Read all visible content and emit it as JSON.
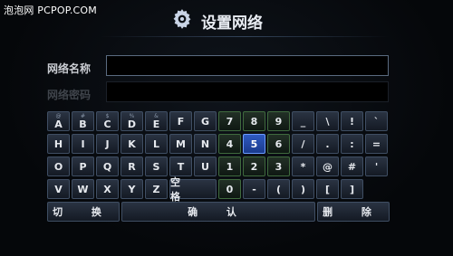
{
  "watermark": "泡泡网 PCPOP.COM",
  "header": {
    "title": "设置网络",
    "icon": "gear-icon"
  },
  "form": {
    "ssid_label": "网络名称",
    "ssid_value": "",
    "password_label": "网络密码",
    "password_value": ""
  },
  "keyboard": {
    "selected_key": "5",
    "rows": [
      [
        {
          "sub": "@",
          "label": "A"
        },
        {
          "sub": "#",
          "label": "B"
        },
        {
          "sub": "$",
          "label": "C"
        },
        {
          "sub": "%",
          "label": "D"
        },
        {
          "sub": "&",
          "label": "E"
        },
        {
          "sub": "",
          "label": "F"
        },
        {
          "sub": "",
          "label": "G"
        },
        {
          "sub": "",
          "label": "7"
        },
        {
          "sub": "",
          "label": "8"
        },
        {
          "sub": "",
          "label": "9"
        },
        {
          "sub": "",
          "label": "_"
        },
        {
          "sub": "",
          "label": "\\"
        },
        {
          "sub": "",
          "label": "!"
        },
        {
          "sub": "",
          "label": "`"
        }
      ],
      [
        {
          "sub": "",
          "label": "H"
        },
        {
          "sub": "",
          "label": "I"
        },
        {
          "sub": "",
          "label": "J"
        },
        {
          "sub": "",
          "label": "K"
        },
        {
          "sub": "",
          "label": "L"
        },
        {
          "sub": "",
          "label": "M"
        },
        {
          "sub": "",
          "label": "N"
        },
        {
          "sub": "",
          "label": "4"
        },
        {
          "sub": "",
          "label": "5"
        },
        {
          "sub": "",
          "label": "6"
        },
        {
          "sub": "",
          "label": "/"
        },
        {
          "sub": "",
          "label": "."
        },
        {
          "sub": "",
          "label": ":"
        },
        {
          "sub": "",
          "label": "="
        }
      ],
      [
        {
          "sub": "",
          "label": "O"
        },
        {
          "sub": "",
          "label": "P"
        },
        {
          "sub": "",
          "label": "Q"
        },
        {
          "sub": "",
          "label": "R"
        },
        {
          "sub": "",
          "label": "S"
        },
        {
          "sub": "",
          "label": "T"
        },
        {
          "sub": "",
          "label": "U"
        },
        {
          "sub": "",
          "label": "1"
        },
        {
          "sub": "",
          "label": "2"
        },
        {
          "sub": "",
          "label": "3"
        },
        {
          "sub": "",
          "label": "*"
        },
        {
          "sub": "",
          "label": "@"
        },
        {
          "sub": "",
          "label": "#"
        },
        {
          "sub": "",
          "label": "'"
        }
      ],
      [
        {
          "sub": "",
          "label": "V"
        },
        {
          "sub": "",
          "label": "W"
        },
        {
          "sub": "",
          "label": "X"
        },
        {
          "sub": "",
          "label": "Y"
        },
        {
          "sub": "",
          "label": "Z"
        },
        {
          "sub": "",
          "label": "空 格"
        },
        {
          "sub": "",
          "label": "0"
        },
        {
          "sub": "",
          "label": "-"
        },
        {
          "sub": "",
          "label": "("
        },
        {
          "sub": "",
          "label": ")"
        },
        {
          "sub": "",
          "label": "["
        },
        {
          "sub": "",
          "label": "]"
        }
      ]
    ],
    "bottom": {
      "switch": "切 换",
      "confirm": "确 认",
      "delete": "删 除"
    }
  }
}
